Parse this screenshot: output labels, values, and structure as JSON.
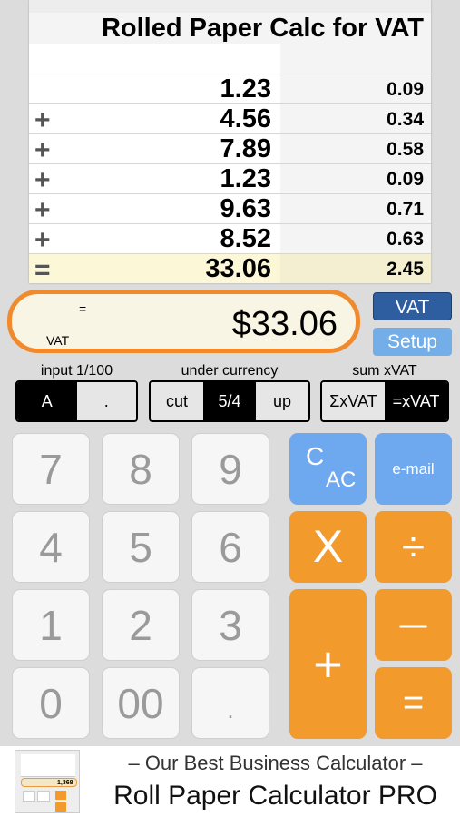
{
  "tape": {
    "title": "Rolled Paper Calc for VAT",
    "rows": [
      {
        "op": "",
        "amount": "1.23",
        "vat": "0.09"
      },
      {
        "op": "+",
        "amount": "4.56",
        "vat": "0.34"
      },
      {
        "op": "+",
        "amount": "7.89",
        "vat": "0.58"
      },
      {
        "op": "+",
        "amount": "1.23",
        "vat": "0.09"
      },
      {
        "op": "+",
        "amount": "9.63",
        "vat": "0.71"
      },
      {
        "op": "+",
        "amount": "8.52",
        "vat": "0.63"
      }
    ],
    "total": {
      "op": "=",
      "amount": "33.06",
      "vat": "2.45"
    }
  },
  "display": {
    "operator": "=",
    "mode": "VAT",
    "value": "$33.06"
  },
  "side": {
    "vat_label": "VAT",
    "setup_label": "Setup"
  },
  "groups": {
    "input": {
      "label": "input 1/100",
      "options": [
        "A",
        "."
      ],
      "selected": "A"
    },
    "under": {
      "label": "under currency",
      "options": [
        "cut",
        "5/4",
        "up"
      ],
      "selected": "5/4"
    },
    "sum": {
      "label": "sum xVAT",
      "options": [
        "ΣxVAT",
        "=xVAT"
      ],
      "selected": "=xVAT"
    }
  },
  "keys": {
    "k7": "7",
    "k8": "8",
    "k9": "9",
    "k4": "4",
    "k5": "5",
    "k6": "6",
    "k1": "1",
    "k2": "2",
    "k3": "3",
    "k0": "0",
    "k00": "00",
    "kdot": ".",
    "clear_top": "C",
    "clear_bottom": "AC",
    "email": "e-mail",
    "multiply": "X",
    "divide": "÷",
    "plus": "+",
    "minus": "—",
    "equals": "="
  },
  "ad": {
    "line1": "– Our Best Business Calculator –",
    "line2": "Roll Paper Calculator PRO",
    "thumb_value": "1,368"
  },
  "colors": {
    "orange": "#f39a2d",
    "display_border": "#f08a2c",
    "blue_dark": "#2e5da0",
    "blue_light": "#6ea8ee",
    "total_row": "#fbf7d7"
  }
}
